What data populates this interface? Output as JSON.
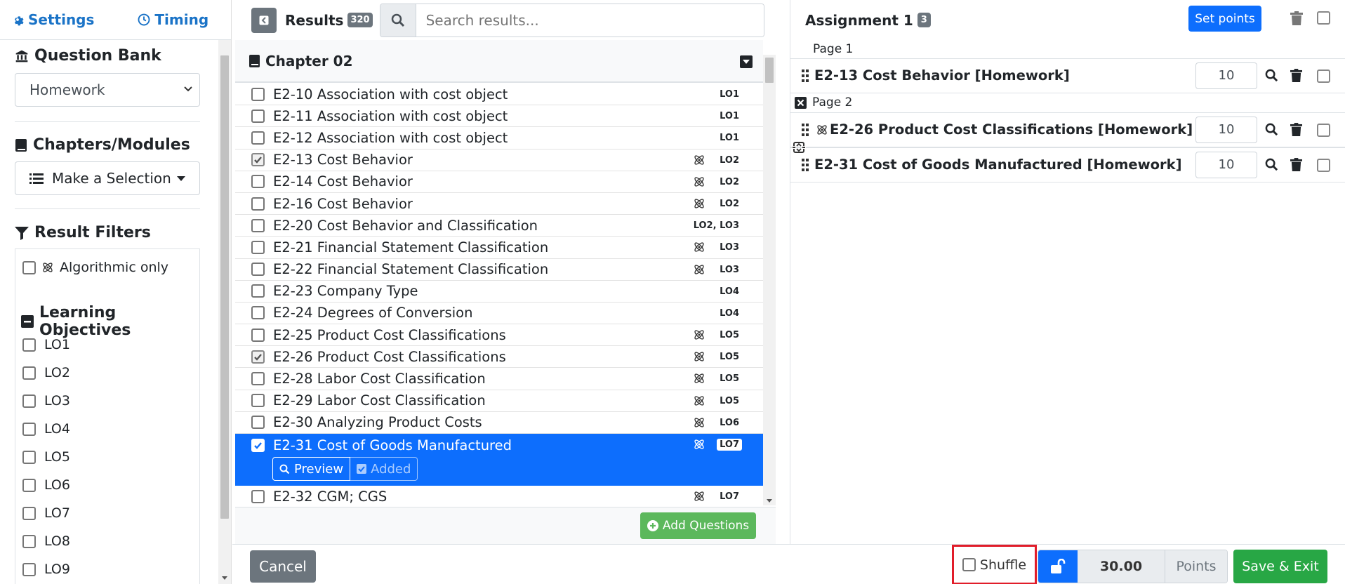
{
  "left": {
    "tabs": {
      "settings": "Settings",
      "timing": "Timing"
    },
    "question_bank": {
      "title": "Question Bank",
      "selected": "Homework"
    },
    "chapters": {
      "title": "Chapters/Modules",
      "button": "Make a Selection"
    },
    "filters": {
      "title": "Result Filters",
      "algorithmic_only": "Algorithmic only"
    },
    "learning_objectives": {
      "title": "Learning Objectives",
      "items": [
        "LO1",
        "LO2",
        "LO3",
        "LO4",
        "LO5",
        "LO6",
        "LO7",
        "LO8",
        "LO9"
      ]
    }
  },
  "results": {
    "title": "Results",
    "count": "320",
    "search_placeholder": "Search results...",
    "chapter": "Chapter 02",
    "rows": [
      {
        "label": "E2-10 Association with cost object",
        "lo": "LO1",
        "algo": false,
        "checked": false
      },
      {
        "label": "E2-11 Association with cost object",
        "lo": "LO1",
        "algo": false,
        "checked": false
      },
      {
        "label": "E2-12 Association with cost object",
        "lo": "LO1",
        "algo": false,
        "checked": false
      },
      {
        "label": "E2-13 Cost Behavior",
        "lo": "LO2",
        "algo": true,
        "checked": true
      },
      {
        "label": "E2-14 Cost Behavior",
        "lo": "LO2",
        "algo": true,
        "checked": false
      },
      {
        "label": "E2-16 Cost Behavior",
        "lo": "LO2",
        "algo": true,
        "checked": false
      },
      {
        "label": "E2-20 Cost Behavior and Classification",
        "lo": "LO2, LO3",
        "algo": false,
        "checked": false
      },
      {
        "label": "E2-21 Financial Statement Classification",
        "lo": "LO3",
        "algo": true,
        "checked": false
      },
      {
        "label": "E2-22 Financial Statement Classification",
        "lo": "LO3",
        "algo": true,
        "checked": false
      },
      {
        "label": "E2-23 Company Type",
        "lo": "LO4",
        "algo": false,
        "checked": false
      },
      {
        "label": "E2-24 Degrees of Conversion",
        "lo": "LO4",
        "algo": false,
        "checked": false
      },
      {
        "label": "E2-25 Product Cost Classifications",
        "lo": "LO5",
        "algo": true,
        "checked": false
      },
      {
        "label": "E2-26 Product Cost Classifications",
        "lo": "LO5",
        "algo": true,
        "checked": true
      },
      {
        "label": "E2-28 Labor Cost Classification",
        "lo": "LO5",
        "algo": true,
        "checked": false
      },
      {
        "label": "E2-29 Labor Cost Classification",
        "lo": "LO5",
        "algo": true,
        "checked": false
      },
      {
        "label": "E2-30 Analyzing Product Costs",
        "lo": "LO6",
        "algo": true,
        "checked": false
      },
      {
        "label": "E2-31 Cost of Goods Manufactured",
        "lo": "LO7",
        "algo": true,
        "checked": true,
        "selected": true
      },
      {
        "label": "E2-32 CGM; CGS",
        "lo": "LO7",
        "algo": true,
        "checked": false
      }
    ],
    "preview_label": "Preview",
    "added_label": "Added",
    "add_questions": "Add Questions"
  },
  "assignment": {
    "title": "Assignment 1",
    "count": "3",
    "set_points": "Set points",
    "page1": "Page 1",
    "page2": "Page 2",
    "items": [
      {
        "label": "E2-13 Cost Behavior [Homework]",
        "points": "10",
        "algo": false
      },
      {
        "label": "E2-26 Product Cost Classifications [Homework]",
        "points": "10",
        "algo": true
      },
      {
        "label": "E2-31 Cost of Goods Manufactured [Homework]",
        "points": "10",
        "algo": false
      }
    ]
  },
  "footer": {
    "cancel": "Cancel",
    "shuffle": "Shuffle",
    "total_points": "30.00",
    "points_label": "Points",
    "save_exit": "Save & Exit"
  },
  "colors": {
    "primary": "#0d6efd",
    "success": "#28a745",
    "secondary": "#6c757d",
    "highlight": "#e11d2a"
  }
}
